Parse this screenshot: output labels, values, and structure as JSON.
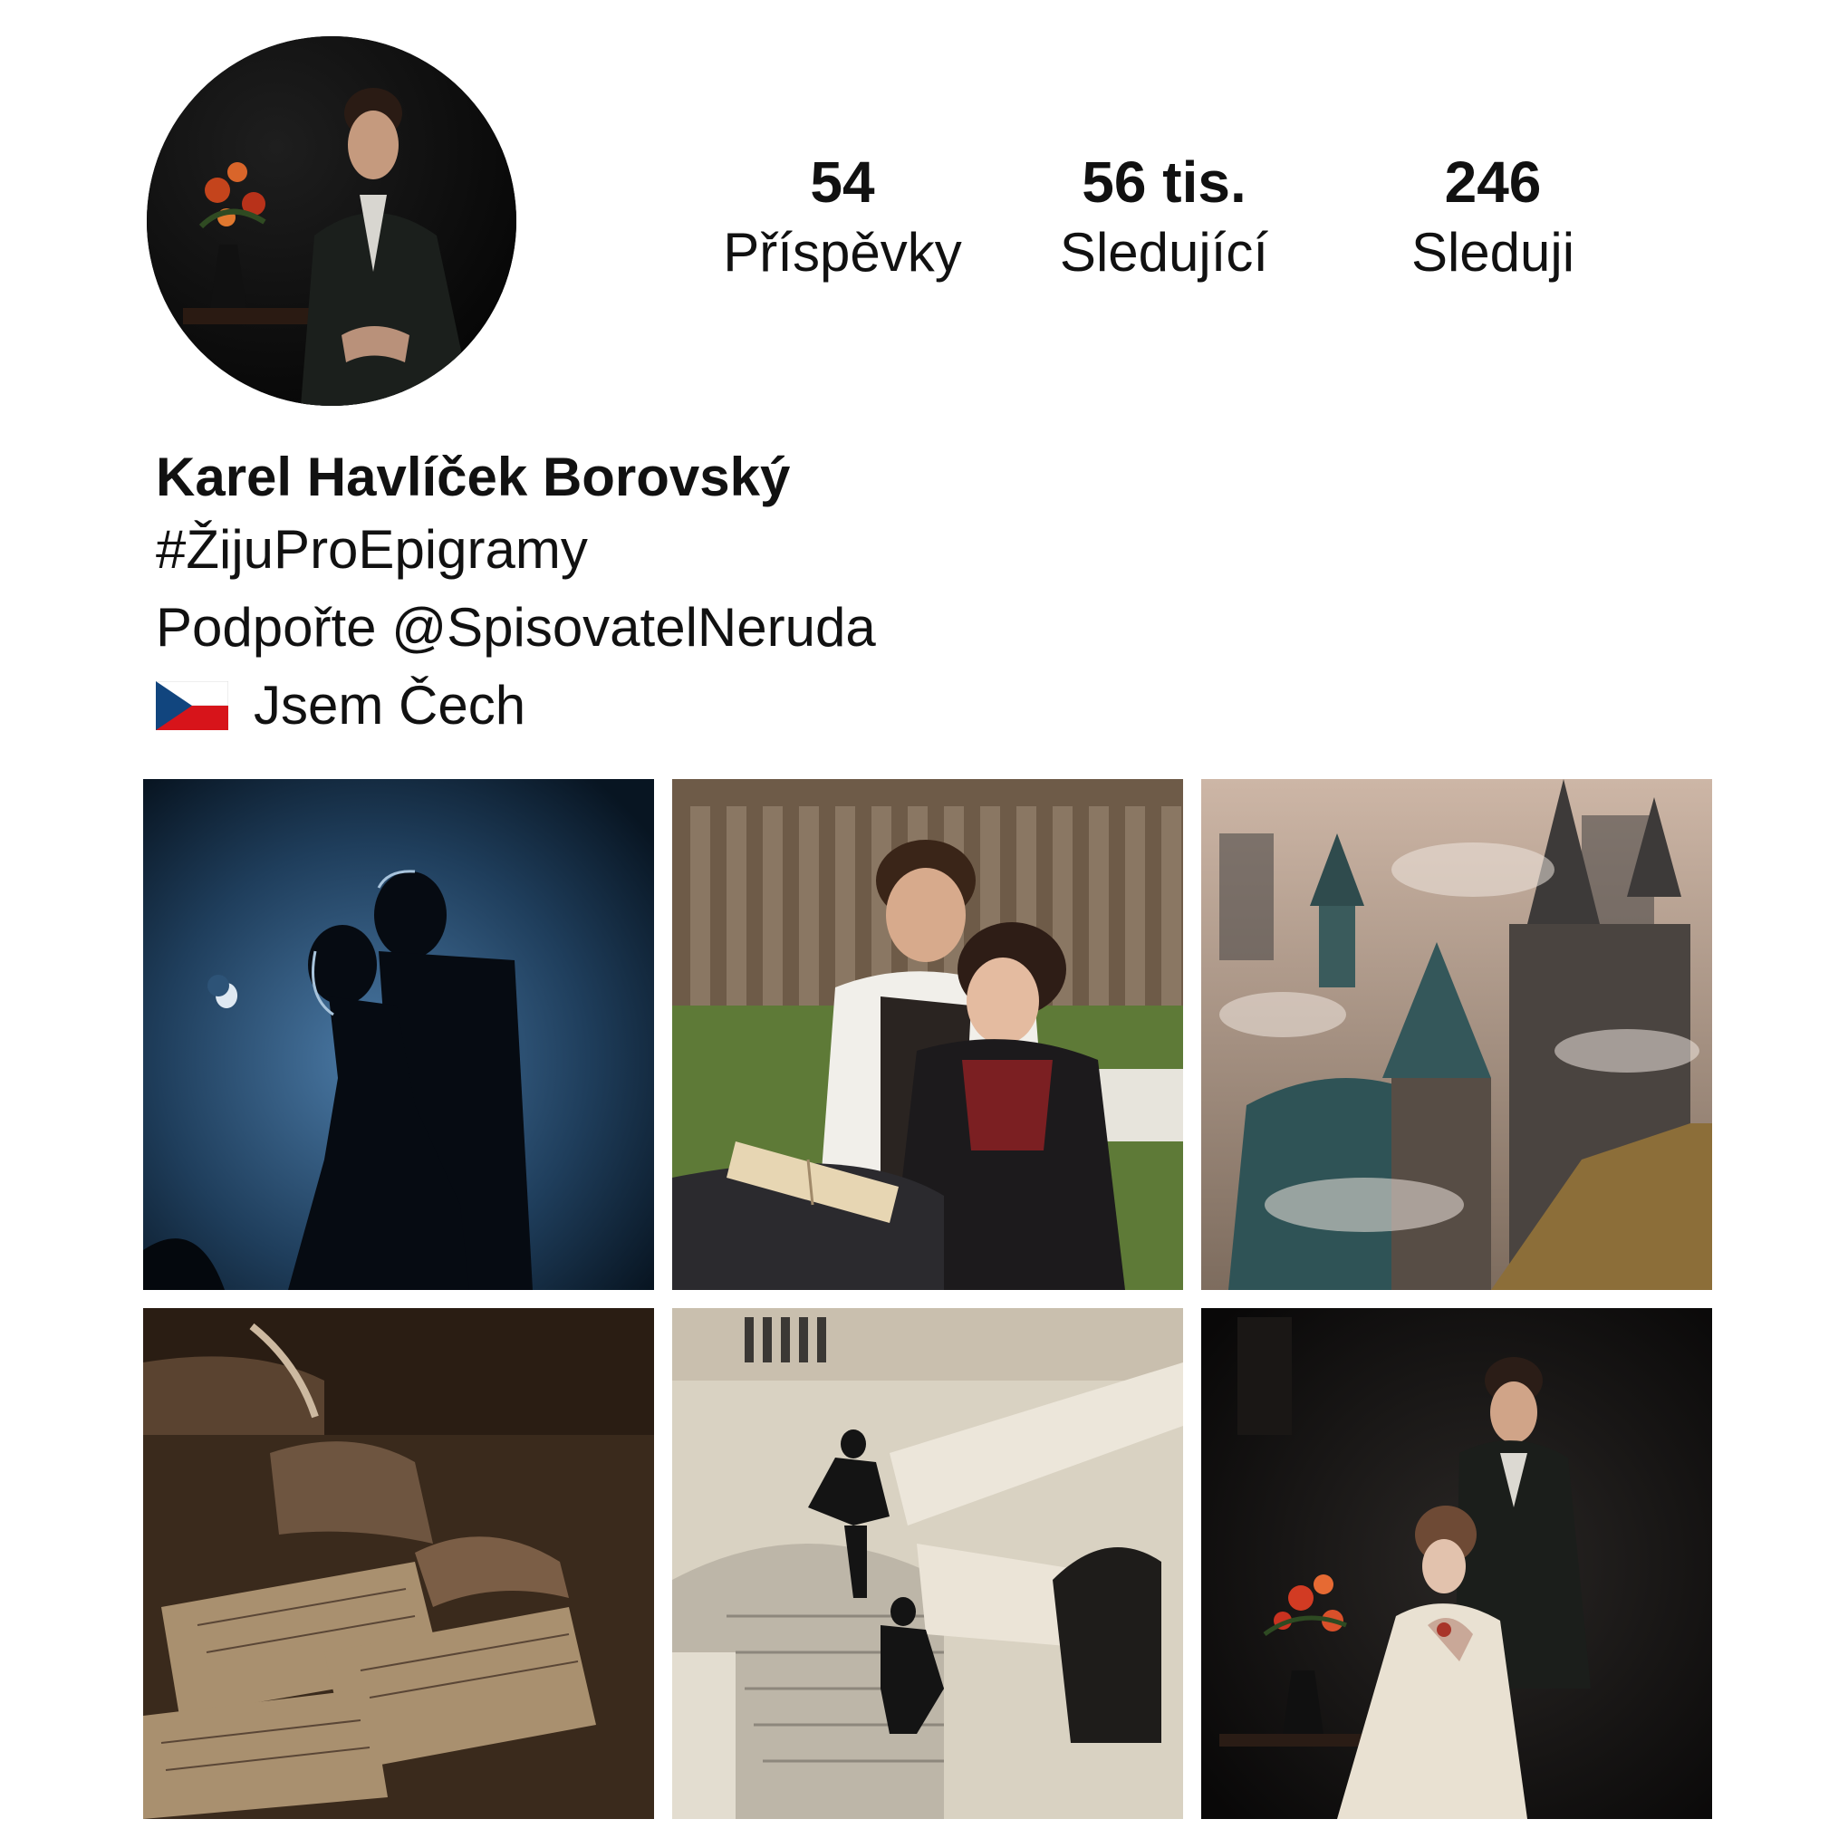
{
  "profile": {
    "name": "Karel Havlíček Borovský",
    "bio_hashtag": "#ŽijuProEpigramy",
    "bio_support_prefix": "Podpořte",
    "bio_mention": "@SpisovatelNeruda",
    "bio_flag_icon": "czech-flag-icon",
    "bio_nationality": "Jsem Čech"
  },
  "stats": {
    "posts": {
      "value": "54",
      "label": "Příspěvky"
    },
    "followers": {
      "value": "56 tis.",
      "label": "Sledující"
    },
    "following": {
      "value": "246",
      "label": "Sleduji"
    }
  },
  "posts": [
    {
      "subject": "couple silhouette under moonlight"
    },
    {
      "subject": "couple reading a book on a bench"
    },
    {
      "subject": "misty Prague towers and rooftops"
    },
    {
      "subject": "hand writing with a quill pen"
    },
    {
      "subject": "men descending a marble staircase"
    },
    {
      "subject": "man standing behind a seated woman"
    }
  ],
  "colors": {
    "text": "#111111",
    "background": "#ffffff",
    "flag_blue": "#11457e",
    "flag_red": "#d7141a"
  }
}
